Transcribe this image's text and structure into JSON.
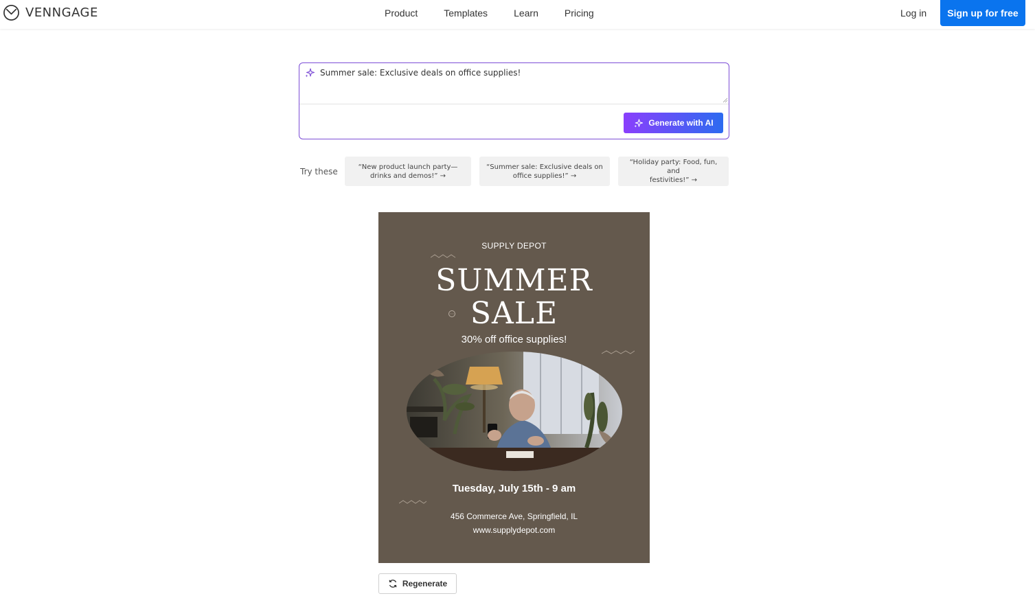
{
  "header": {
    "brand": "VENNGAGE",
    "nav": [
      "Product",
      "Templates",
      "Learn",
      "Pricing"
    ],
    "login": "Log in",
    "signup": "Sign up for free"
  },
  "prompt": {
    "value": "Summer sale: Exclusive deals on office supplies!",
    "generate_label": "Generate with AI"
  },
  "suggestions": {
    "label": "Try these",
    "chips": [
      {
        "line1": "“New product launch party—",
        "line2": "drinks and demos!” →"
      },
      {
        "line1": "“Summer sale: Exclusive deals on",
        "line2": "office supplies!” →"
      },
      {
        "line1": "“Holiday party: Food, fun, and",
        "line2": "festivities!” →"
      }
    ]
  },
  "poster": {
    "brand": "SUPPLY DEPOT",
    "title_line1": "SUMMER",
    "title_line2": "SALE",
    "subtitle": "30% off office supplies!",
    "date": "Tuesday, July 15th - 9 am",
    "address": "456 Commerce Ave, Springfield, IL",
    "website": "www.supplydepot.com",
    "background_color": "#64594d"
  },
  "actions": {
    "regenerate": "Regenerate"
  },
  "colors": {
    "accent_blue": "#0a74ee",
    "ai_gradient_start": "#8a3ffc",
    "ai_gradient_end": "#2d6bf0",
    "prompt_border": "#7c4dd6"
  }
}
